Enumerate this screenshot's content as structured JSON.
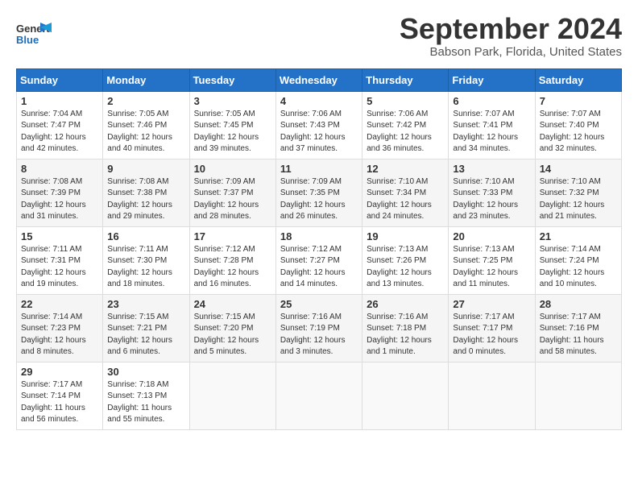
{
  "header": {
    "logo_line1": "General",
    "logo_line2": "Blue",
    "month": "September 2024",
    "location": "Babson Park, Florida, United States"
  },
  "days_of_week": [
    "Sunday",
    "Monday",
    "Tuesday",
    "Wednesday",
    "Thursday",
    "Friday",
    "Saturday"
  ],
  "weeks": [
    [
      {
        "day": "1",
        "sunrise": "7:04 AM",
        "sunset": "7:47 PM",
        "daylight": "12 hours and 42 minutes."
      },
      {
        "day": "2",
        "sunrise": "7:05 AM",
        "sunset": "7:46 PM",
        "daylight": "12 hours and 40 minutes."
      },
      {
        "day": "3",
        "sunrise": "7:05 AM",
        "sunset": "7:45 PM",
        "daylight": "12 hours and 39 minutes."
      },
      {
        "day": "4",
        "sunrise": "7:06 AM",
        "sunset": "7:43 PM",
        "daylight": "12 hours and 37 minutes."
      },
      {
        "day": "5",
        "sunrise": "7:06 AM",
        "sunset": "7:42 PM",
        "daylight": "12 hours and 36 minutes."
      },
      {
        "day": "6",
        "sunrise": "7:07 AM",
        "sunset": "7:41 PM",
        "daylight": "12 hours and 34 minutes."
      },
      {
        "day": "7",
        "sunrise": "7:07 AM",
        "sunset": "7:40 PM",
        "daylight": "12 hours and 32 minutes."
      }
    ],
    [
      {
        "day": "8",
        "sunrise": "7:08 AM",
        "sunset": "7:39 PM",
        "daylight": "12 hours and 31 minutes."
      },
      {
        "day": "9",
        "sunrise": "7:08 AM",
        "sunset": "7:38 PM",
        "daylight": "12 hours and 29 minutes."
      },
      {
        "day": "10",
        "sunrise": "7:09 AM",
        "sunset": "7:37 PM",
        "daylight": "12 hours and 28 minutes."
      },
      {
        "day": "11",
        "sunrise": "7:09 AM",
        "sunset": "7:35 PM",
        "daylight": "12 hours and 26 minutes."
      },
      {
        "day": "12",
        "sunrise": "7:10 AM",
        "sunset": "7:34 PM",
        "daylight": "12 hours and 24 minutes."
      },
      {
        "day": "13",
        "sunrise": "7:10 AM",
        "sunset": "7:33 PM",
        "daylight": "12 hours and 23 minutes."
      },
      {
        "day": "14",
        "sunrise": "7:10 AM",
        "sunset": "7:32 PM",
        "daylight": "12 hours and 21 minutes."
      }
    ],
    [
      {
        "day": "15",
        "sunrise": "7:11 AM",
        "sunset": "7:31 PM",
        "daylight": "12 hours and 19 minutes."
      },
      {
        "day": "16",
        "sunrise": "7:11 AM",
        "sunset": "7:30 PM",
        "daylight": "12 hours and 18 minutes."
      },
      {
        "day": "17",
        "sunrise": "7:12 AM",
        "sunset": "7:28 PM",
        "daylight": "12 hours and 16 minutes."
      },
      {
        "day": "18",
        "sunrise": "7:12 AM",
        "sunset": "7:27 PM",
        "daylight": "12 hours and 14 minutes."
      },
      {
        "day": "19",
        "sunrise": "7:13 AM",
        "sunset": "7:26 PM",
        "daylight": "12 hours and 13 minutes."
      },
      {
        "day": "20",
        "sunrise": "7:13 AM",
        "sunset": "7:25 PM",
        "daylight": "12 hours and 11 minutes."
      },
      {
        "day": "21",
        "sunrise": "7:14 AM",
        "sunset": "7:24 PM",
        "daylight": "12 hours and 10 minutes."
      }
    ],
    [
      {
        "day": "22",
        "sunrise": "7:14 AM",
        "sunset": "7:23 PM",
        "daylight": "12 hours and 8 minutes."
      },
      {
        "day": "23",
        "sunrise": "7:15 AM",
        "sunset": "7:21 PM",
        "daylight": "12 hours and 6 minutes."
      },
      {
        "day": "24",
        "sunrise": "7:15 AM",
        "sunset": "7:20 PM",
        "daylight": "12 hours and 5 minutes."
      },
      {
        "day": "25",
        "sunrise": "7:16 AM",
        "sunset": "7:19 PM",
        "daylight": "12 hours and 3 minutes."
      },
      {
        "day": "26",
        "sunrise": "7:16 AM",
        "sunset": "7:18 PM",
        "daylight": "12 hours and 1 minute."
      },
      {
        "day": "27",
        "sunrise": "7:17 AM",
        "sunset": "7:17 PM",
        "daylight": "12 hours and 0 minutes."
      },
      {
        "day": "28",
        "sunrise": "7:17 AM",
        "sunset": "7:16 PM",
        "daylight": "11 hours and 58 minutes."
      }
    ],
    [
      {
        "day": "29",
        "sunrise": "7:17 AM",
        "sunset": "7:14 PM",
        "daylight": "11 hours and 56 minutes."
      },
      {
        "day": "30",
        "sunrise": "7:18 AM",
        "sunset": "7:13 PM",
        "daylight": "11 hours and 55 minutes."
      },
      null,
      null,
      null,
      null,
      null
    ]
  ],
  "labels": {
    "sunrise": "Sunrise:",
    "sunset": "Sunset:",
    "daylight": "Daylight:"
  }
}
